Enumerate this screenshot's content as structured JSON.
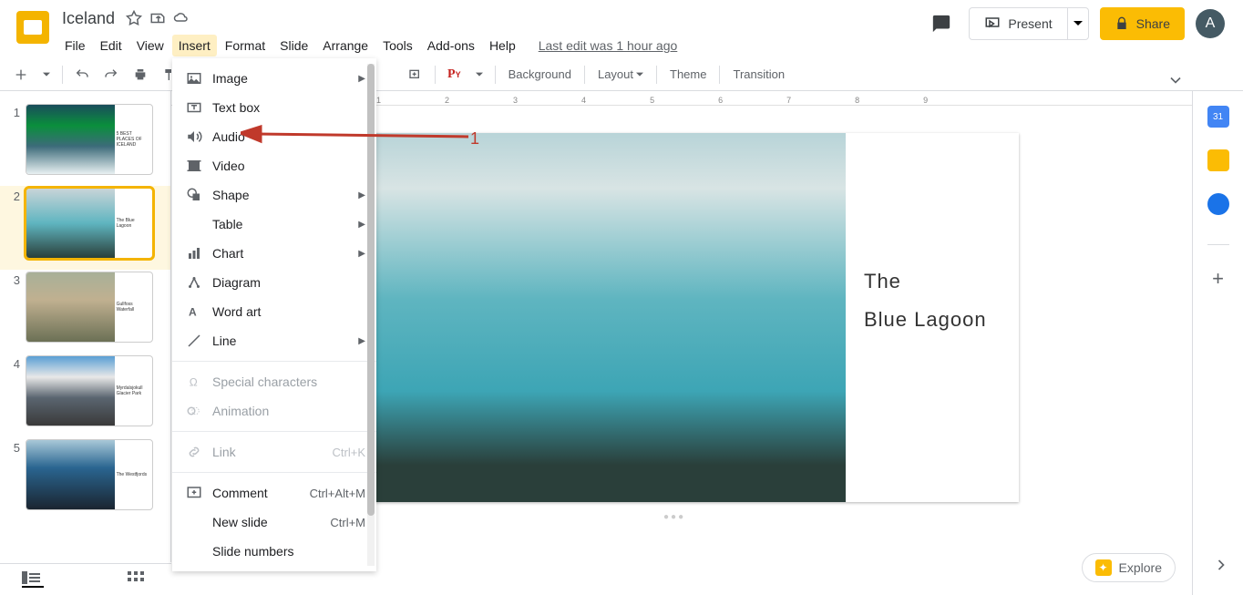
{
  "header": {
    "title": "Iceland",
    "avatar_letter": "A",
    "last_edit": "Last edit was 1 hour ago",
    "present_label": "Present",
    "share_label": "Share"
  },
  "menubar": {
    "items": [
      "File",
      "Edit",
      "View",
      "Insert",
      "Format",
      "Slide",
      "Arrange",
      "Tools",
      "Add-ons",
      "Help"
    ],
    "active_index": 3
  },
  "toolbar": {
    "background": "Background",
    "layout": "Layout",
    "theme": "Theme",
    "transition": "Transition"
  },
  "dropdown": {
    "items": [
      {
        "icon": "image-icon",
        "label": "Image",
        "has_submenu": true
      },
      {
        "icon": "textbox-icon",
        "label": "Text box"
      },
      {
        "icon": "audio-icon",
        "label": "Audio"
      },
      {
        "icon": "video-icon",
        "label": "Video"
      },
      {
        "icon": "shape-icon",
        "label": "Shape",
        "has_submenu": true
      },
      {
        "icon": "table-icon",
        "label": "Table",
        "has_submenu": true
      },
      {
        "icon": "chart-icon",
        "label": "Chart",
        "has_submenu": true
      },
      {
        "icon": "diagram-icon",
        "label": "Diagram"
      },
      {
        "icon": "wordart-icon",
        "label": "Word art"
      },
      {
        "icon": "line-icon",
        "label": "Line",
        "has_submenu": true
      },
      {
        "separator": true
      },
      {
        "icon": "specialchars-icon",
        "label": "Special characters",
        "disabled": true
      },
      {
        "icon": "animation-icon",
        "label": "Animation",
        "disabled": true
      },
      {
        "separator": true
      },
      {
        "icon": "link-icon",
        "label": "Link",
        "shortcut": "Ctrl+K",
        "disabled": true
      },
      {
        "separator": true
      },
      {
        "icon": "comment-icon",
        "label": "Comment",
        "shortcut": "Ctrl+Alt+M"
      },
      {
        "icon": "",
        "label": "New slide",
        "shortcut": "Ctrl+M"
      },
      {
        "icon": "",
        "label": "Slide numbers"
      }
    ]
  },
  "annotation": {
    "number": "1"
  },
  "filmstrip": {
    "thumbs": [
      {
        "num": "1",
        "caption": "5 BEST PLACES OF ICELAND",
        "gradient": "g1"
      },
      {
        "num": "2",
        "caption": "The Blue Lagoon",
        "gradient": "g2",
        "selected": true
      },
      {
        "num": "3",
        "caption": "Gullfoss Waterfall",
        "gradient": "g3"
      },
      {
        "num": "4",
        "caption": "Myrdalsjokull Glacier Park",
        "gradient": "g4"
      },
      {
        "num": "5",
        "caption": "The Westfjords",
        "gradient": "g5"
      }
    ]
  },
  "slide": {
    "title_line1": "The",
    "title_line2": "Blue Lagoon"
  },
  "ruler": {
    "marks": [
      "1",
      "2",
      "3",
      "4",
      "5",
      "6",
      "7",
      "8",
      "9"
    ]
  },
  "explore": {
    "label": "Explore"
  },
  "sidebar": {
    "calendar_day": "31"
  }
}
